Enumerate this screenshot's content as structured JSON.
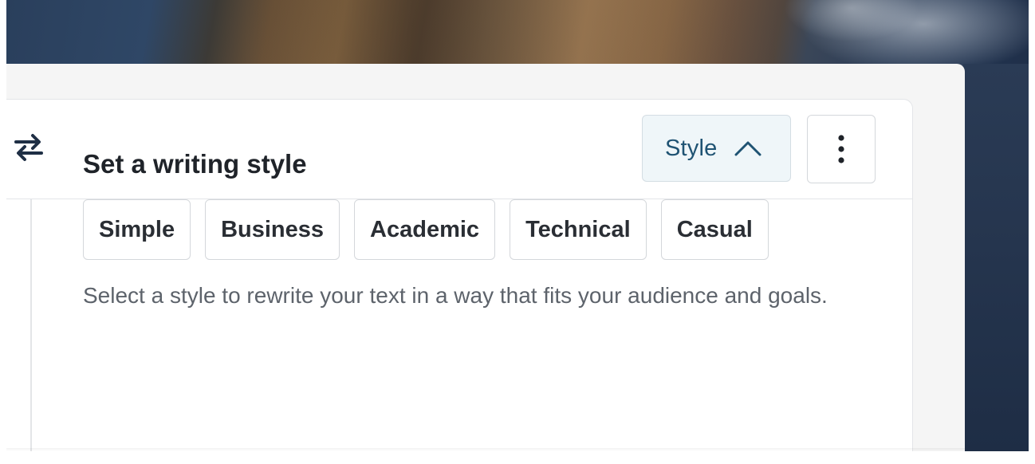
{
  "toolbar": {
    "swap_icon": "swap-arrows-icon",
    "style_button_label": "Style",
    "style_chevron_icon": "chevron-up-icon",
    "more_icon": "vertical-ellipsis-icon"
  },
  "style_panel": {
    "title": "Set a writing style",
    "options": [
      {
        "label": "Simple"
      },
      {
        "label": "Business"
      },
      {
        "label": "Academic"
      },
      {
        "label": "Technical"
      },
      {
        "label": "Casual"
      }
    ],
    "description": "Select a style to rewrite your text in a way that fits your audience and goals."
  },
  "colors": {
    "accent_text": "#1f5373",
    "accent_bg": "#eff6f9",
    "icon_dark": "#1f2f45"
  }
}
